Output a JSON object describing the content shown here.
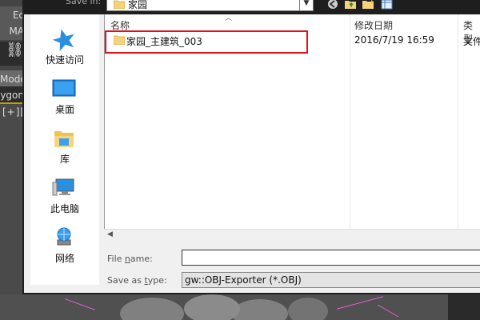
{
  "background_app": {
    "buttons": [
      "Ec",
      "MA",
      "Mode",
      "ygon"
    ],
    "viewport_label": "[+]["
  },
  "dialog": {
    "save_in": {
      "label": "Save in:",
      "value": "家园"
    },
    "places": [
      {
        "label": "快速访问",
        "icon": "quick-access-star-icon"
      },
      {
        "label": "桌面",
        "icon": "desktop-icon"
      },
      {
        "label": "库",
        "icon": "library-icon"
      },
      {
        "label": "此电脑",
        "icon": "this-pc-icon"
      },
      {
        "label": "网络",
        "icon": "network-icon"
      }
    ],
    "columns": {
      "name": "名称",
      "date": "修改日期",
      "type": "类型"
    },
    "files": [
      {
        "name": "家园_主建筑_003",
        "date": "2016/7/19 16:59",
        "type": "文件"
      }
    ],
    "file_name": {
      "label_prefix": "File ",
      "label_underlined": "n",
      "label_suffix": "ame:",
      "value": ""
    },
    "save_as_type": {
      "label_prefix": "Save as ",
      "label_underlined": "t",
      "label_suffix": "ype:",
      "value": "gw::OBJ-Exporter (*.OBJ)"
    }
  },
  "colors": {
    "highlight": "#e0101e",
    "folder": "#f6d27a",
    "star": "#2b8fe0"
  }
}
